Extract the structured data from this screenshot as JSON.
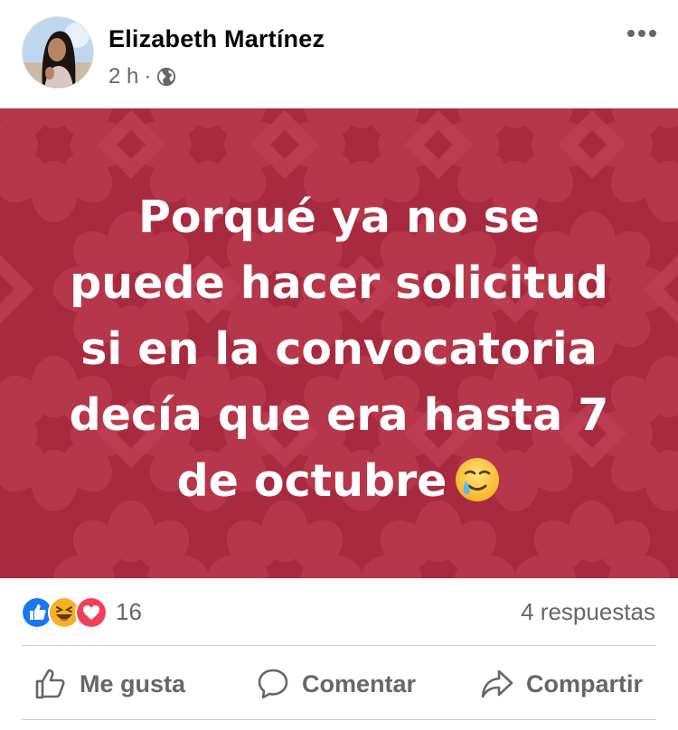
{
  "post": {
    "author_name": "Elizabeth Martínez",
    "time": "2 h",
    "separator": "·",
    "privacy_icon": "globe-icon",
    "more_icon": "more-options-icon",
    "status_lines": [
      "Porqué ya no se",
      "puede hacer solicitud",
      "si en la convocatoria",
      "decía que era hasta 7",
      "de octubre"
    ],
    "status_emoji": "smiling-face-with-tear-icon",
    "background_color": "#a82a3f"
  },
  "reactions": {
    "icons": [
      "like-icon",
      "haha-icon",
      "love-icon"
    ],
    "count": "16",
    "comments": "4 respuestas"
  },
  "actions": {
    "like_label": "Me gusta",
    "comment_label": "Comentar",
    "share_label": "Compartir"
  },
  "colors": {
    "like_blue": "#1877f2",
    "love_red": "#f33e58",
    "haha_yellow": "#f7b125",
    "secondary_text": "#65676b"
  }
}
